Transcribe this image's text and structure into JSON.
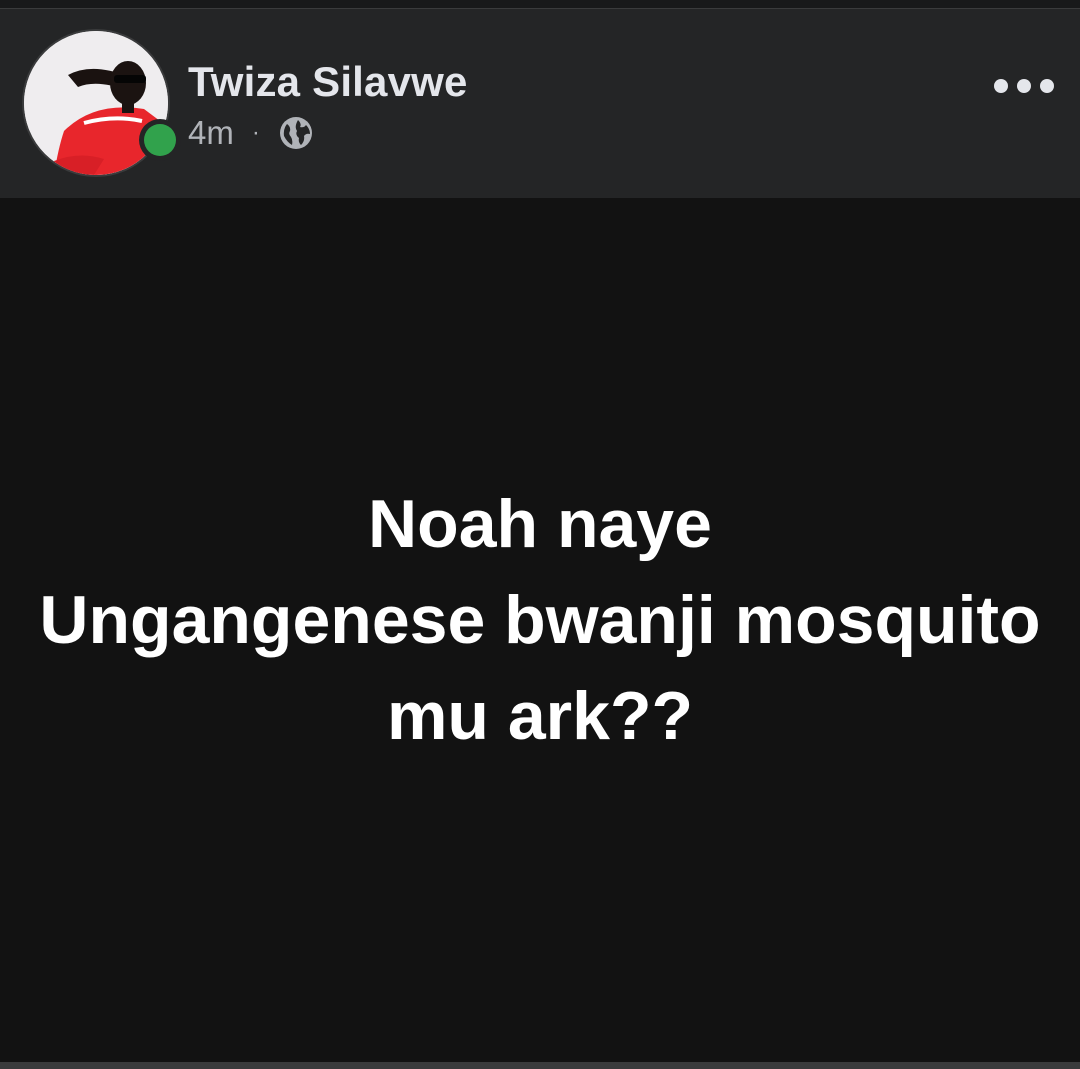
{
  "post": {
    "author_name": "Twiza Silavwe",
    "timestamp": "4m",
    "separator": "·",
    "audience_icon": "globe-icon",
    "online_status": "online",
    "menu_icon": "more-options-icon",
    "text_lines": [
      "Noah naye",
      "Ungangenese bwanji mosquito",
      "mu ark??"
    ]
  },
  "colors": {
    "header_bg": "#242526",
    "body_bg": "#121212",
    "online_green": "#31a24c",
    "name_text": "#e4e6eb",
    "meta_text": "#b0b3b8"
  }
}
